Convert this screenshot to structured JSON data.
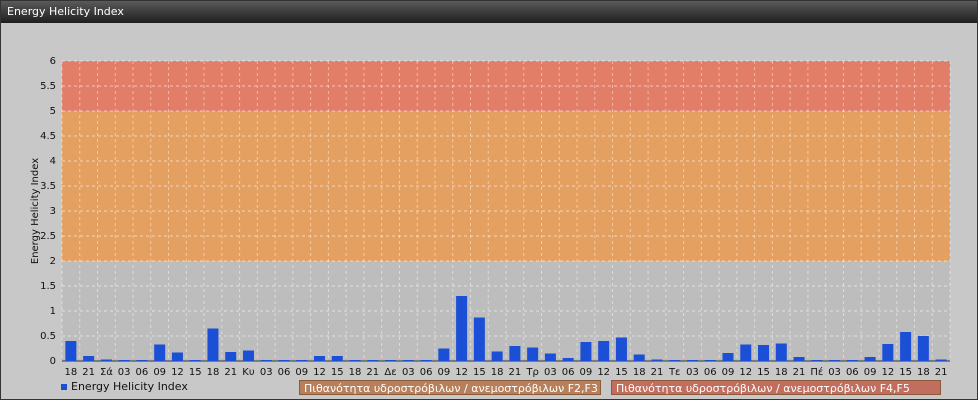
{
  "window": {
    "title": "Energy Helicity Index"
  },
  "chart_data": {
    "type": "bar",
    "ylabel": "Energy Helicity Index",
    "ylim": [
      0,
      6
    ],
    "yticks": [
      "0",
      "0.5",
      "1",
      "1.5",
      "2",
      "2.5",
      "3",
      "3.5",
      "4",
      "4.5",
      "5",
      "5.5",
      "6"
    ],
    "categories": [
      "18",
      "21",
      "Σά",
      "03",
      "06",
      "09",
      "12",
      "15",
      "18",
      "21",
      "Κυ",
      "03",
      "06",
      "09",
      "12",
      "15",
      "18",
      "21",
      "Δε",
      "03",
      "06",
      "09",
      "12",
      "15",
      "18",
      "21",
      "Τρ",
      "03",
      "06",
      "09",
      "12",
      "15",
      "18",
      "21",
      "Τε",
      "03",
      "06",
      "09",
      "12",
      "15",
      "18",
      "21",
      "Πέ",
      "03",
      "06",
      "09",
      "12",
      "15",
      "18",
      "21"
    ],
    "series": [
      {
        "name": "Energy Helicity Index",
        "color": "#1a4fd6",
        "values": [
          0.4,
          0.1,
          0.03,
          0.02,
          0.02,
          0.33,
          0.17,
          0.02,
          0.65,
          0.18,
          0.21,
          0.02,
          0.02,
          0.02,
          0.1,
          0.1,
          0.02,
          0.02,
          0.02,
          0.02,
          0.02,
          0.25,
          1.3,
          0.87,
          0.19,
          0.3,
          0.27,
          0.15,
          0.06,
          0.38,
          0.4,
          0.47,
          0.13,
          0.03,
          0.02,
          0.02,
          0.02,
          0.16,
          0.33,
          0.32,
          0.35,
          0.08,
          0.02,
          0.02,
          0.02,
          0.08,
          0.34,
          0.58,
          0.5,
          0.03
        ]
      }
    ],
    "bands": [
      {
        "from": 2,
        "to": 5,
        "color": "#e4a060",
        "label": "Πιθανότητα υδροστρόβιλων / ανεμοστρόβιλων F2,F3"
      },
      {
        "from": 5,
        "to": 6,
        "color": "#e27d68",
        "label": "Πιθανότητα υδροστρόβιλων / ανεμοστρόβιλων F4,F5"
      }
    ],
    "grid": true,
    "legend": "bottom-left"
  }
}
